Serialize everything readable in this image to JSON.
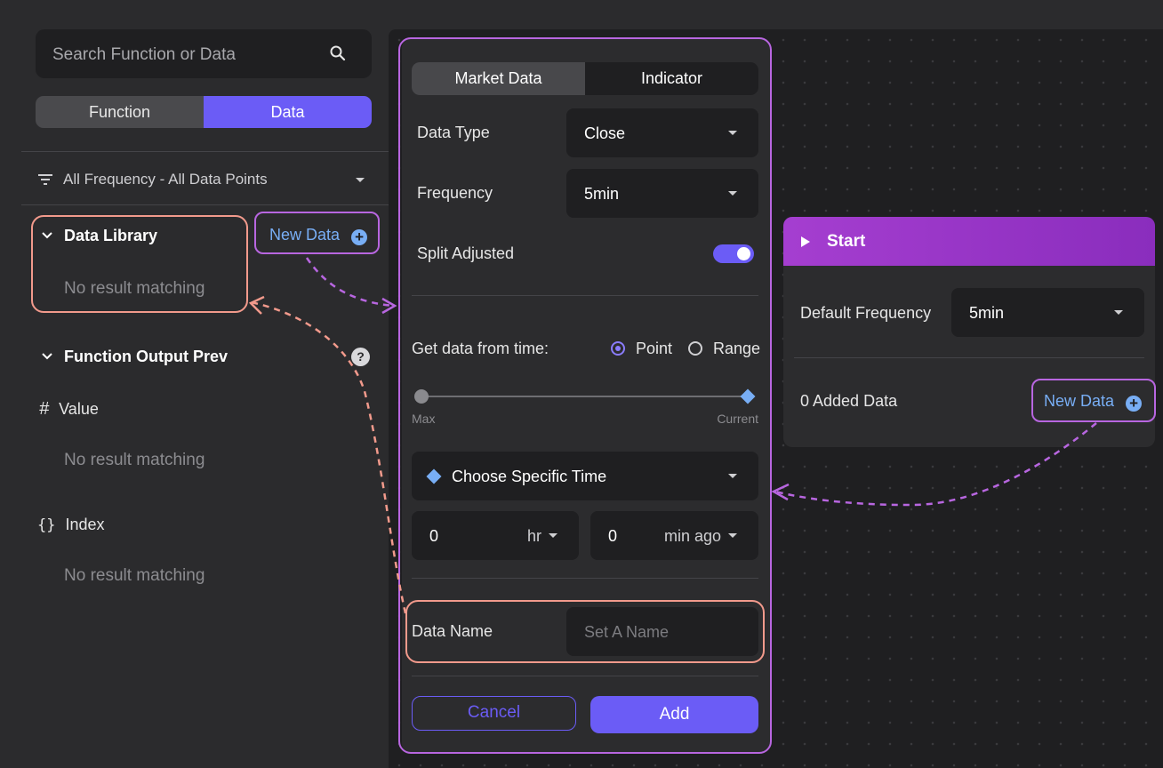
{
  "sidebar": {
    "search_placeholder": "Search Function or Data",
    "tab_function": "Function",
    "tab_data": "Data",
    "filter_label": "All Frequency - All Data Points",
    "data_library": {
      "title": "Data Library",
      "new_data_label": "New Data",
      "empty_text": "No result matching"
    },
    "function_output": {
      "title": "Function Output Prev",
      "help": "?",
      "value_label": "Value",
      "value_empty": "No result matching",
      "index_label": "Index",
      "index_empty": "No result matching"
    }
  },
  "data_form": {
    "tab_market": "Market Data",
    "tab_indicator": "Indicator",
    "data_type_label": "Data Type",
    "data_type_value": "Close",
    "frequency_label": "Frequency",
    "frequency_value": "5min",
    "split_adjusted_label": "Split Adjusted",
    "split_adjusted_on": true,
    "get_data_label": "Get data from time:",
    "radio_point": "Point",
    "radio_range": "Range",
    "selected_mode": "Point",
    "slider_min_label": "Max",
    "slider_max_label": "Current",
    "slider_value": 1.0,
    "choose_time_label": "Choose Specific Time",
    "hours_value": "0",
    "hours_unit": "hr",
    "minutes_value": "0",
    "minutes_unit": "min ago",
    "data_name_label": "Data Name",
    "data_name_placeholder": "Set A Name",
    "cancel_label": "Cancel",
    "add_label": "Add"
  },
  "start_node": {
    "title": "Start",
    "default_frequency_label": "Default Frequency",
    "default_frequency_value": "5min",
    "added_data_label": "0 Added Data",
    "new_data_label": "New Data"
  },
  "colors": {
    "accent": "#6b5cf6",
    "link": "#78aef5",
    "annotation_purple": "#b866e0",
    "annotation_salmon": "#f29a8c"
  }
}
